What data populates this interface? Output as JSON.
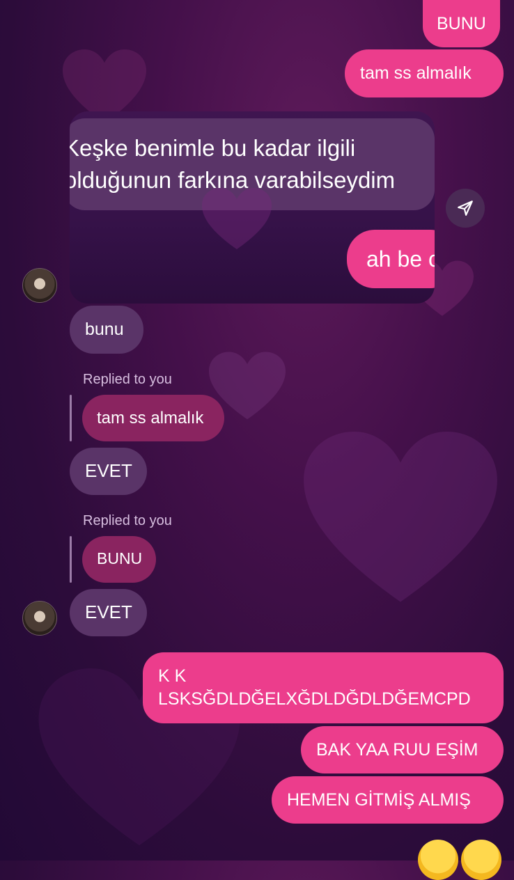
{
  "messages": {
    "out_bunu": "BUNU",
    "out_tam_ss": "tam ss almalık",
    "story_line1": "Keşke benimle bu kadar ilgili",
    "story_line2": "olduğunun farkına varabilseydim",
    "story_reply": "ah be c",
    "in_bunu": "bunu",
    "replied_label_1": "Replied to you",
    "quoted_1": "tam ss almalık",
    "in_evet_1": "EVET",
    "replied_label_2": "Replied to you",
    "quoted_2": "BUNU",
    "in_evet_2": "EVET",
    "out_kk_line1": "K K",
    "out_kk_line2": "LSKSĞDLDĞELXĞDLDĞDLDĞEMCPD",
    "out_bak": "BAK YAA RUU EŞİM",
    "out_hemen": "HEMEN GİTMİŞ ALMIŞ"
  },
  "icons": {
    "share": "send-icon",
    "emoji": "heart-eyes-emoji"
  },
  "colors": {
    "outgoing": "#ec3d8c",
    "incoming": "#5a3468",
    "quoted": "#8a2460"
  }
}
